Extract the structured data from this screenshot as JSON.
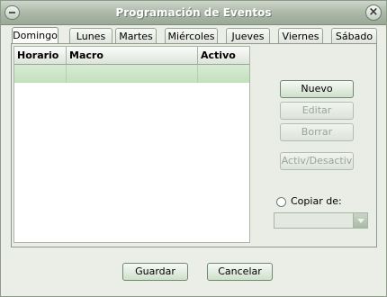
{
  "window": {
    "title": "Programación de Eventos"
  },
  "tabs": [
    "Domingo",
    "Lunes",
    "Martes",
    "Miércoles",
    "Jueves",
    "Viernes",
    "Sábado"
  ],
  "table": {
    "columns": [
      "Horario",
      "Macro",
      "Activo"
    ],
    "rows": []
  },
  "buttons": {
    "nuevo": "Nuevo",
    "editar": "Editar",
    "borrar": "Borrar",
    "activ": "Activ/Desactiv",
    "guardar": "Guardar",
    "cancelar": "Cancelar"
  },
  "copy": {
    "label": "Copiar de:",
    "selected": ""
  },
  "colors": {
    "accent": "#c2e0bd",
    "title_bar": "#aebbab"
  },
  "icons": {
    "menu": "window-menu-icon",
    "close": "close-icon",
    "dropdown": "chevron-down-icon"
  }
}
